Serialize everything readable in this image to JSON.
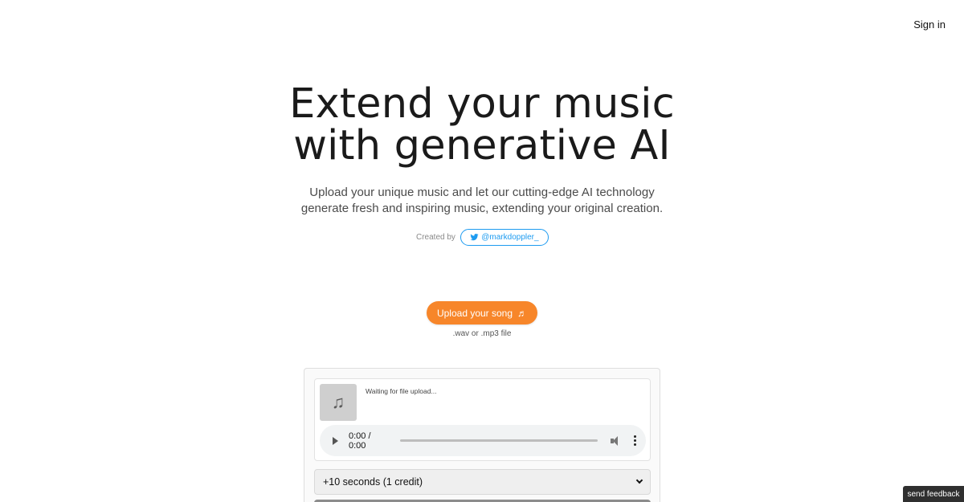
{
  "header": {
    "signin_label": "Sign in"
  },
  "hero": {
    "title_line1": "Extend your music",
    "title_line2": "with generative AI",
    "subtitle_line1": "Upload your unique music and let our cutting-edge AI technology",
    "subtitle_line2": "generate fresh and inspiring music, extending your original creation."
  },
  "creator": {
    "label": "Created by",
    "handle": "@markdoppler_",
    "icon": "twitter-icon",
    "color": "#1d9bf0"
  },
  "upload": {
    "button_label": "Upload your song",
    "button_icon": "♬",
    "hint": ".wav or .mp3 file",
    "accent": "#f7862a"
  },
  "panel": {
    "thumb_icon": "♫",
    "status_text": "Waiting for file upload...",
    "player_time": "0:00 / 0:00",
    "select_value": "+10 seconds (1 credit)"
  },
  "feedback": {
    "label": "send feedback"
  }
}
